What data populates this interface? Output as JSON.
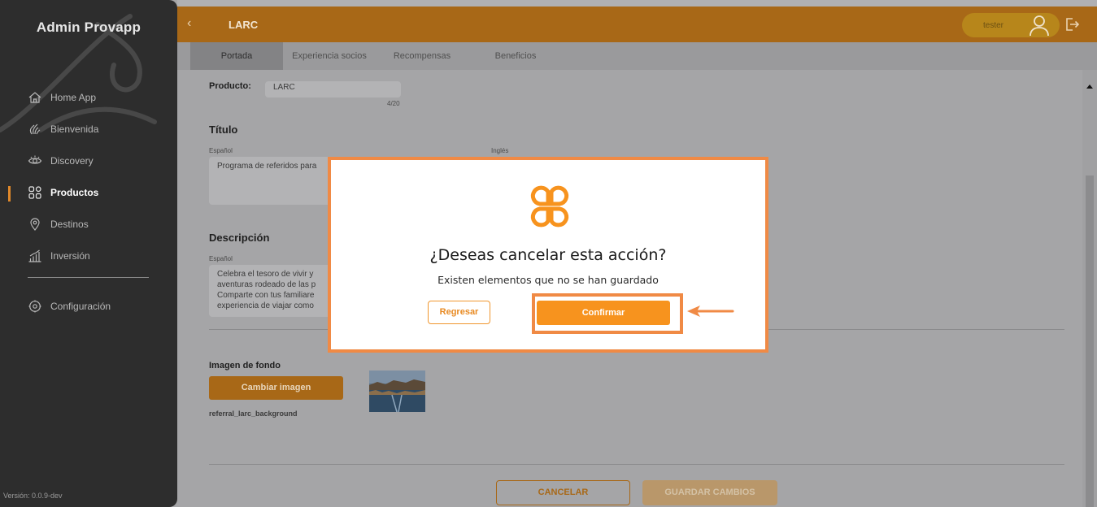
{
  "app": {
    "brand": "Admin Provapp",
    "version": "Versión: 0.0.9-dev"
  },
  "sidebar": {
    "items": [
      {
        "label": "Home App",
        "icon": "home-icon",
        "active": false
      },
      {
        "label": "Bienvenida",
        "icon": "wave-hand-icon",
        "active": false
      },
      {
        "label": "Discovery",
        "icon": "eye-icon",
        "active": false
      },
      {
        "label": "Productos",
        "icon": "grid-icon",
        "active": true
      },
      {
        "label": "Destinos",
        "icon": "location-pin-icon",
        "active": false
      },
      {
        "label": "Inversión",
        "icon": "bar-chart-icon",
        "active": false
      }
    ],
    "config": {
      "label": "Configuración",
      "icon": "gear-icon"
    }
  },
  "header": {
    "title": "LARC",
    "user": "tester",
    "accent": "#a86817"
  },
  "tabs": [
    {
      "label": "Portada",
      "active": true
    },
    {
      "label": "Experiencia socios",
      "active": false
    },
    {
      "label": "Recompensas",
      "active": false
    },
    {
      "label": "Beneficios",
      "active": false
    }
  ],
  "form": {
    "product_label": "Producto:",
    "product_value": "LARC",
    "product_counter": "4/20",
    "title_section": "Título",
    "spanish_label": "Español",
    "english_label": "Inglés",
    "title_es": "Programa de referidos para",
    "description_section": "Descripción",
    "description_es": "Celebra el tesoro de vivir y\naventuras rodeado de las p\nComparte con tus familiare\nexperiencia de viajar como",
    "background_label": "Imagen de fondo",
    "change_image_button": "Cambiar imagen",
    "image_filename": "referral_larc_background",
    "cancel_button": "CANCELAR",
    "save_button": "GUARDAR CAMBIOS"
  },
  "modal": {
    "title": "¿Deseas cancelar esta acción?",
    "subtitle": "Existen elementos que no se han guardado",
    "back_button": "Regresar",
    "confirm_button": "Confirmar",
    "accent": "#f7931e",
    "highlight": "#f08a45"
  }
}
